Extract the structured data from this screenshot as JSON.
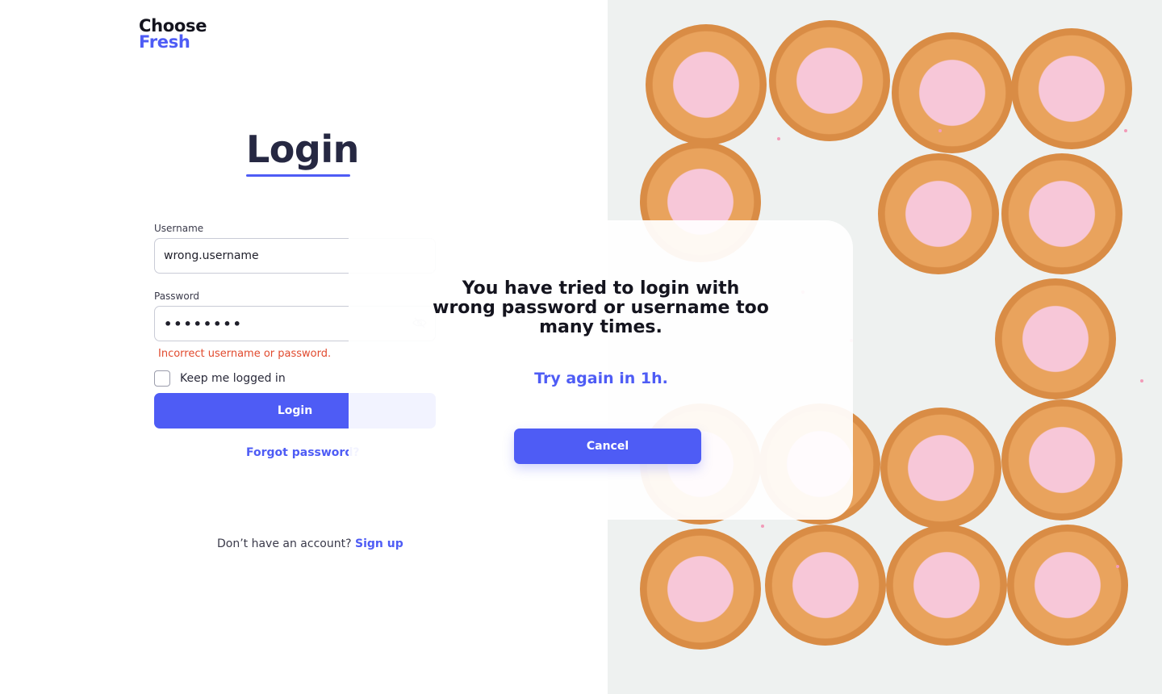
{
  "brand": {
    "line1": "Choose",
    "line2": "Fresh"
  },
  "form": {
    "title": "Login",
    "username_label": "Username",
    "username_value": "wrong.username",
    "password_label": "Password",
    "password_value": "••••••••",
    "error": "Incorrect username or password.",
    "remember_label": "Keep me logged in",
    "remember_checked": false,
    "login_button": "Login",
    "forgot_link": "Forgot password?",
    "signup_prompt": "Don’t have an account?",
    "signup_link": "Sign up"
  },
  "modal": {
    "message": "You have tried to login with wrong password or username too many times.",
    "retry": "Try again in 1h.",
    "cancel_button": "Cancel"
  },
  "colors": {
    "accent": "#4e5cf5",
    "error": "#e14a2e",
    "title": "#262842"
  },
  "icons": {
    "password_toggle": "eye-off-icon"
  }
}
